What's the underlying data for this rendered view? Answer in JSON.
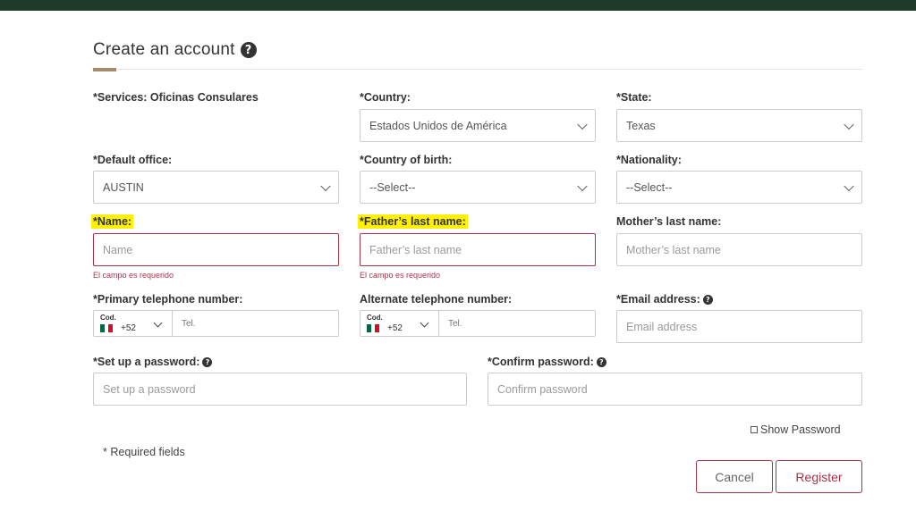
{
  "header": {
    "title": "Create an account",
    "help_icon": "question-circle-icon"
  },
  "colors": {
    "topbar": "#1e3a2b",
    "accent": "#a48b6a",
    "error": "#a8324a",
    "highlight": "#fff100"
  },
  "fields": {
    "services": {
      "label": "*Services: Oficinas Consulares"
    },
    "country": {
      "label": "*Country:",
      "value": "Estados Unidos de América"
    },
    "state": {
      "label": "*State:",
      "value": "Texas"
    },
    "default_office": {
      "label": "*Default office:",
      "value": "AUSTIN"
    },
    "country_of_birth": {
      "label": "*Country of birth:",
      "value": "--Select--"
    },
    "nationality": {
      "label": "*Nationality:",
      "value": "--Select--"
    },
    "name": {
      "label": "*Name:",
      "placeholder": "Name",
      "error": "El campo es requerido"
    },
    "father_last_name": {
      "label": "*Father’s last name:",
      "placeholder": "Father’s last name",
      "error": "El campo es requerido"
    },
    "mother_last_name": {
      "label": "Mother’s last name:",
      "placeholder": "Mother’s last name"
    },
    "primary_phone": {
      "label": "*Primary telephone number:",
      "code_label": "Cod.",
      "code": "+52",
      "placeholder": "Tel."
    },
    "alternate_phone": {
      "label": "Alternate telephone number:",
      "code_label": "Cod.",
      "code": "+52",
      "placeholder": "Tel."
    },
    "email": {
      "label": "*Email address:",
      "placeholder": "Email address"
    },
    "password": {
      "label": "*Set up a password:",
      "placeholder": "Set up a password"
    },
    "confirm_password": {
      "label": "*Confirm password:",
      "placeholder": "Confirm password"
    }
  },
  "show_password": "Show Password",
  "required_note": "* Required fields",
  "buttons": {
    "cancel": "Cancel",
    "register": "Register"
  }
}
